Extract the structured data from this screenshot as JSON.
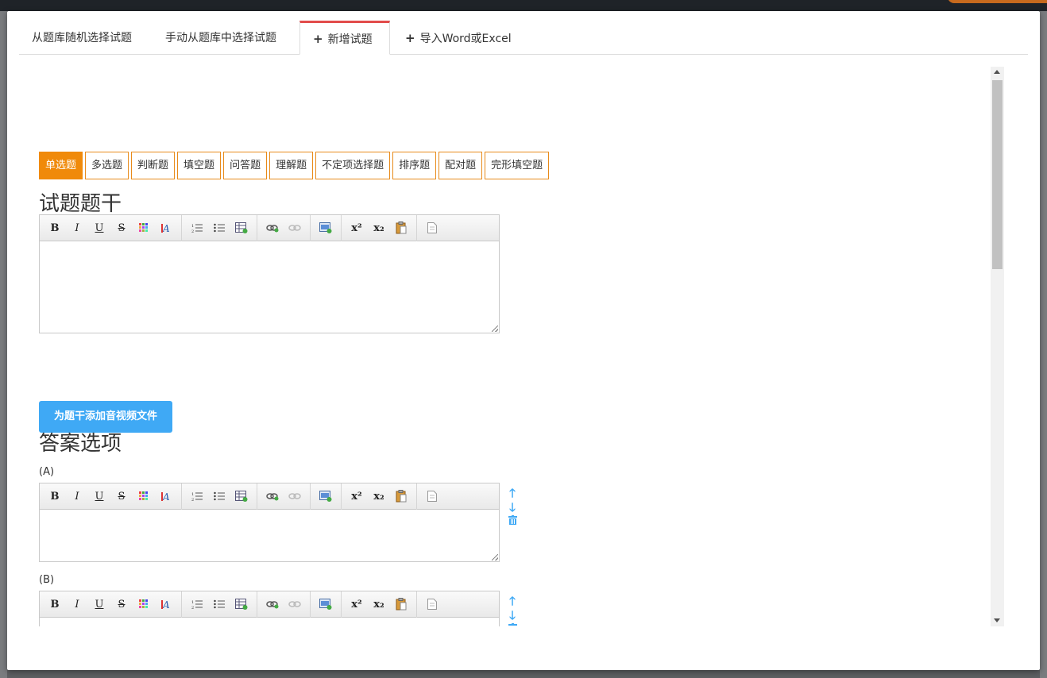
{
  "tabs": [
    {
      "label": "从题库随机选择试题"
    },
    {
      "label": "手动从题库中选择试题"
    },
    {
      "label": "新增试题"
    },
    {
      "label": "导入Word或Excel"
    }
  ],
  "question_types": [
    "单选题",
    "多选题",
    "判断题",
    "填空题",
    "问答题",
    "理解题",
    "不定项选择题",
    "排序题",
    "配对题",
    "完形填空题"
  ],
  "stem": {
    "title": "试题题干",
    "media_button": "为题干添加音视频文件"
  },
  "answers": {
    "title": "答案选项",
    "options": [
      {
        "label": "(A)"
      },
      {
        "label": "(B)"
      }
    ]
  },
  "toolbar": {
    "bold": "B",
    "italic": "I",
    "underline": "U",
    "strike": "S",
    "superscript": "x²",
    "subscript": "x₂"
  },
  "colors": {
    "accent": "#f08a0a",
    "primary": "#3fa9f5",
    "active_tab_border": "#e24c4b"
  }
}
